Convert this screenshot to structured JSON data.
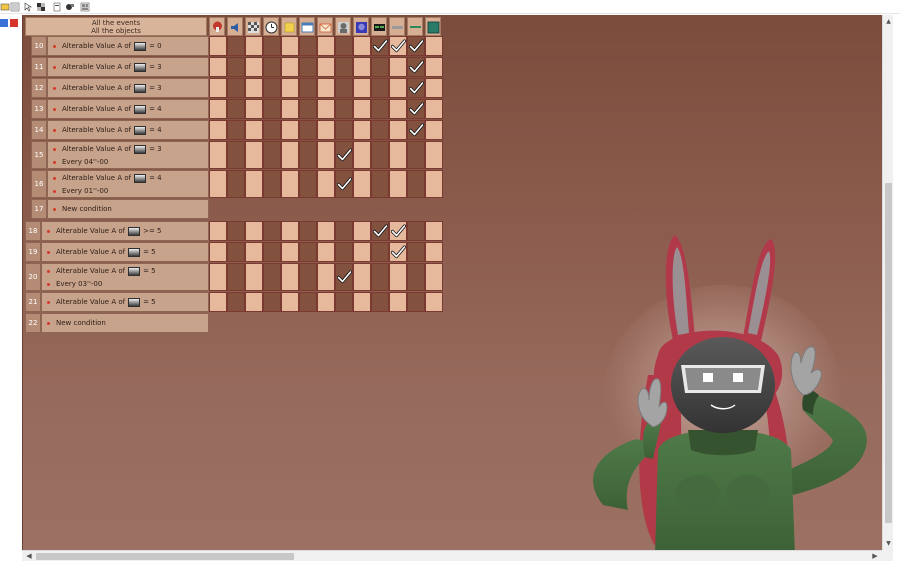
{
  "header": {
    "line1": "All the events",
    "line2": "All the objects"
  },
  "objects": [
    {
      "icon": "mushroom-icon",
      "color": "#c0392b"
    },
    {
      "icon": "speaker-icon",
      "color": "#2a5fa8"
    },
    {
      "icon": "checkerboard-icon",
      "color": "#555555"
    },
    {
      "icon": "clock-icon",
      "color": "#2e2e2e"
    },
    {
      "icon": "note-icon",
      "color": "#f2d04b"
    },
    {
      "icon": "window-icon",
      "color": "#4a7cb8"
    },
    {
      "icon": "mail-icon",
      "color": "#d05a3a"
    },
    {
      "icon": "character-icon",
      "color": "#6a6a6a"
    },
    {
      "icon": "portrait-icon",
      "color": "#3a3ab8"
    },
    {
      "icon": "black-box-icon",
      "color": "#1a1a1a"
    },
    {
      "icon": "strip-icon",
      "color": "#9a9a9a"
    },
    {
      "icon": "green-line-icon",
      "color": "#2a8a5a"
    },
    {
      "icon": "teal-square-icon",
      "color": "#2a7a6a"
    }
  ],
  "events": [
    {
      "num": "10",
      "indent": 1,
      "lines": [
        {
          "pre": "Alterable Value A of",
          "post": "= 0"
        }
      ],
      "checks": [
        9,
        10,
        11
      ]
    },
    {
      "num": "11",
      "indent": 1,
      "lines": [
        {
          "pre": "Alterable Value A of",
          "post": "= 3"
        }
      ],
      "checks": [
        11
      ]
    },
    {
      "num": "12",
      "indent": 1,
      "lines": [
        {
          "pre": "Alterable Value A of",
          "post": "= 3"
        }
      ],
      "checks": [
        11
      ]
    },
    {
      "num": "13",
      "indent": 1,
      "lines": [
        {
          "pre": "Alterable Value A of",
          "post": "= 4"
        }
      ],
      "checks": [
        11
      ]
    },
    {
      "num": "14",
      "indent": 1,
      "lines": [
        {
          "pre": "Alterable Value A of",
          "post": "= 4"
        }
      ],
      "checks": [
        11
      ]
    },
    {
      "num": "15",
      "indent": 1,
      "lines": [
        {
          "pre": "Alterable Value A of",
          "post": "= 3"
        },
        {
          "pre": "Every 04''-00",
          "post": ""
        }
      ],
      "checks": [
        7
      ]
    },
    {
      "num": "16",
      "indent": 1,
      "lines": [
        {
          "pre": "Alterable Value A of",
          "post": "= 4"
        },
        {
          "pre": "Every 01''-00",
          "post": ""
        }
      ],
      "checks": [
        7
      ]
    },
    {
      "num": "17",
      "indent": 1,
      "lines": [
        {
          "pre": "New condition",
          "post": ""
        }
      ],
      "checks": null
    },
    {
      "num": "18",
      "indent": 0,
      "lines": [
        {
          "pre": "Alterable Value A of",
          "post": ">= 5"
        }
      ],
      "checks": [
        9,
        10
      ]
    },
    {
      "num": "19",
      "indent": 0,
      "lines": [
        {
          "pre": "Alterable Value A of",
          "post": "= 5"
        }
      ],
      "checks": [
        10
      ]
    },
    {
      "num": "20",
      "indent": 0,
      "lines": [
        {
          "pre": "Alterable Value A of",
          "post": "= 5"
        },
        {
          "pre": "Every 03''-00",
          "post": ""
        }
      ],
      "checks": [
        7
      ]
    },
    {
      "num": "21",
      "indent": 0,
      "lines": [
        {
          "pre": "Alterable Value A of",
          "post": "= 5"
        }
      ],
      "checks": []
    },
    {
      "num": "22",
      "indent": 0,
      "lines": [
        {
          "pre": "New condition",
          "post": ""
        }
      ],
      "checks": null
    }
  ]
}
